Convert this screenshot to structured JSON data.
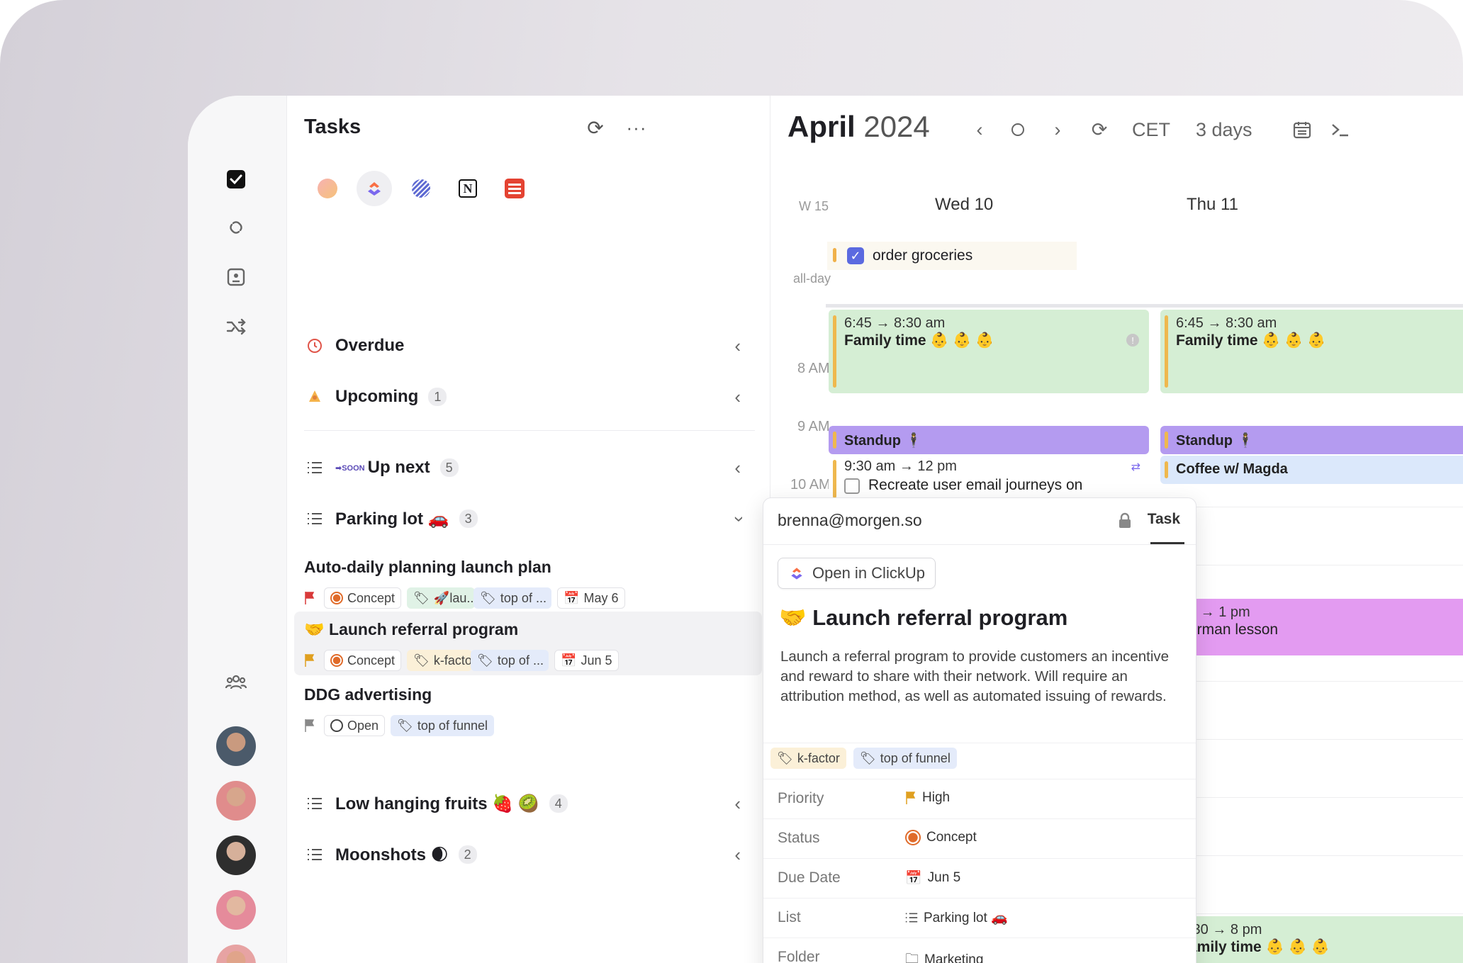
{
  "tasks_panel": {
    "title": "Tasks",
    "sources": [
      "circle-source-icon",
      "clickup-icon",
      "linear-icon",
      "notion-icon",
      "todoist-icon"
    ],
    "sections": [
      {
        "label": "Overdue",
        "count": ""
      },
      {
        "label": "Upcoming",
        "count": "1"
      },
      {
        "label": "Up next",
        "count": "5"
      },
      {
        "label": "Parking lot 🚗",
        "count": "3"
      },
      {
        "label": "Low hanging fruits 🍓 🥝",
        "count": "4"
      },
      {
        "label": "Moonshots 🌒",
        "count": "2"
      }
    ],
    "tasks": [
      {
        "title": "Auto-daily planning launch plan",
        "status": "Concept",
        "tag1": "🚀lau..",
        "tag2": "top of ...",
        "date": "May 6"
      },
      {
        "title": "🤝 Launch referral program",
        "status": "Concept",
        "tag1": "k-facto",
        "tag2": "top of ...",
        "date": "Jun 5"
      },
      {
        "title": "DDG advertising",
        "status": "Open",
        "tag1": "top of funnel"
      }
    ]
  },
  "calendar": {
    "month": "April",
    "year": "2024",
    "timezone": "CET",
    "range": "3 days",
    "week": "W 15",
    "allday_label": "all-day",
    "days": [
      "Wed 10",
      "Thu 11"
    ],
    "hours": [
      "8 AM",
      "9 AM",
      "10 AM"
    ],
    "events": {
      "order_groceries": "order groceries",
      "family_wed_time": "6:45 → 8:30 am",
      "family_wed_title": "Family time 👶 👶 👶",
      "family_thu_time": "6:45 → 8:30 am",
      "family_thu_title": "Family time 👶 👶 👶",
      "standup_wed": "Standup 🕴",
      "standup_thu": "Standup 🕴",
      "recreate_time": "9:30 am → 12 pm",
      "recreate_title": "Recreate user email journeys on",
      "coffee": "Coffee w/ Magda",
      "german_time": "2 → 1 pm",
      "german_title": "erman lesson",
      "family_eve_time": ":30 → 8 pm",
      "family_eve_title": "amily time 👶 👶 👶"
    }
  },
  "popover": {
    "account": "brenna@morgen.so",
    "tab": "Task",
    "open_button": "Open in ClickUp",
    "title": "🤝 Launch referral program",
    "description": "Launch a referral program to provide customers an incentive and reward to share with their network. Will require an attribution method, as well as automated issuing of rewards.",
    "tags": [
      "k-factor",
      "top of funnel"
    ],
    "properties": {
      "priority_label": "Priority",
      "priority": "High",
      "status_label": "Status",
      "status": "Concept",
      "due_label": "Due Date",
      "due": "Jun 5",
      "list_label": "List",
      "list": "Parking lot 🚗",
      "folder_label": "Folder",
      "folder": "Marketing"
    }
  },
  "colors": {
    "accent_purple": "#b39ef7",
    "green_event": "#d6efd5",
    "pink_event": "#e59cf2",
    "blue_event": "#dbe8fb",
    "status_orange": "#e06b2a"
  }
}
